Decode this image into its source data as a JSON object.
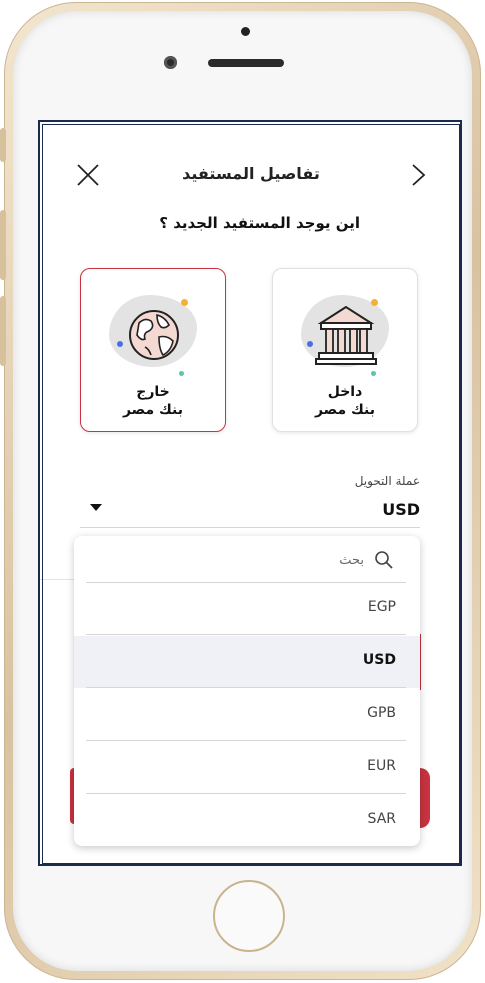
{
  "header": {
    "title": "تفاصيل المستفيد"
  },
  "question": "اين يوجد المستفيد الجديد ؟",
  "cards": {
    "outside": {
      "line1": "خارج",
      "line2": "بنك مصر",
      "icon": "globe-icon"
    },
    "inside": {
      "line1": "داخل",
      "line2": "بنك مصر",
      "icon": "bank-icon"
    }
  },
  "currency": {
    "label": "عملة التحويل",
    "value": "USD"
  },
  "dropdown": {
    "search_placeholder": "بحث",
    "options": [
      "EGP",
      "USD",
      "GPB",
      "EUR",
      "SAR"
    ],
    "selected": "USD"
  },
  "colors": {
    "accent": "#c7333f",
    "frame": "#1c2b4d",
    "selected_bg": "#f0f1f6"
  }
}
